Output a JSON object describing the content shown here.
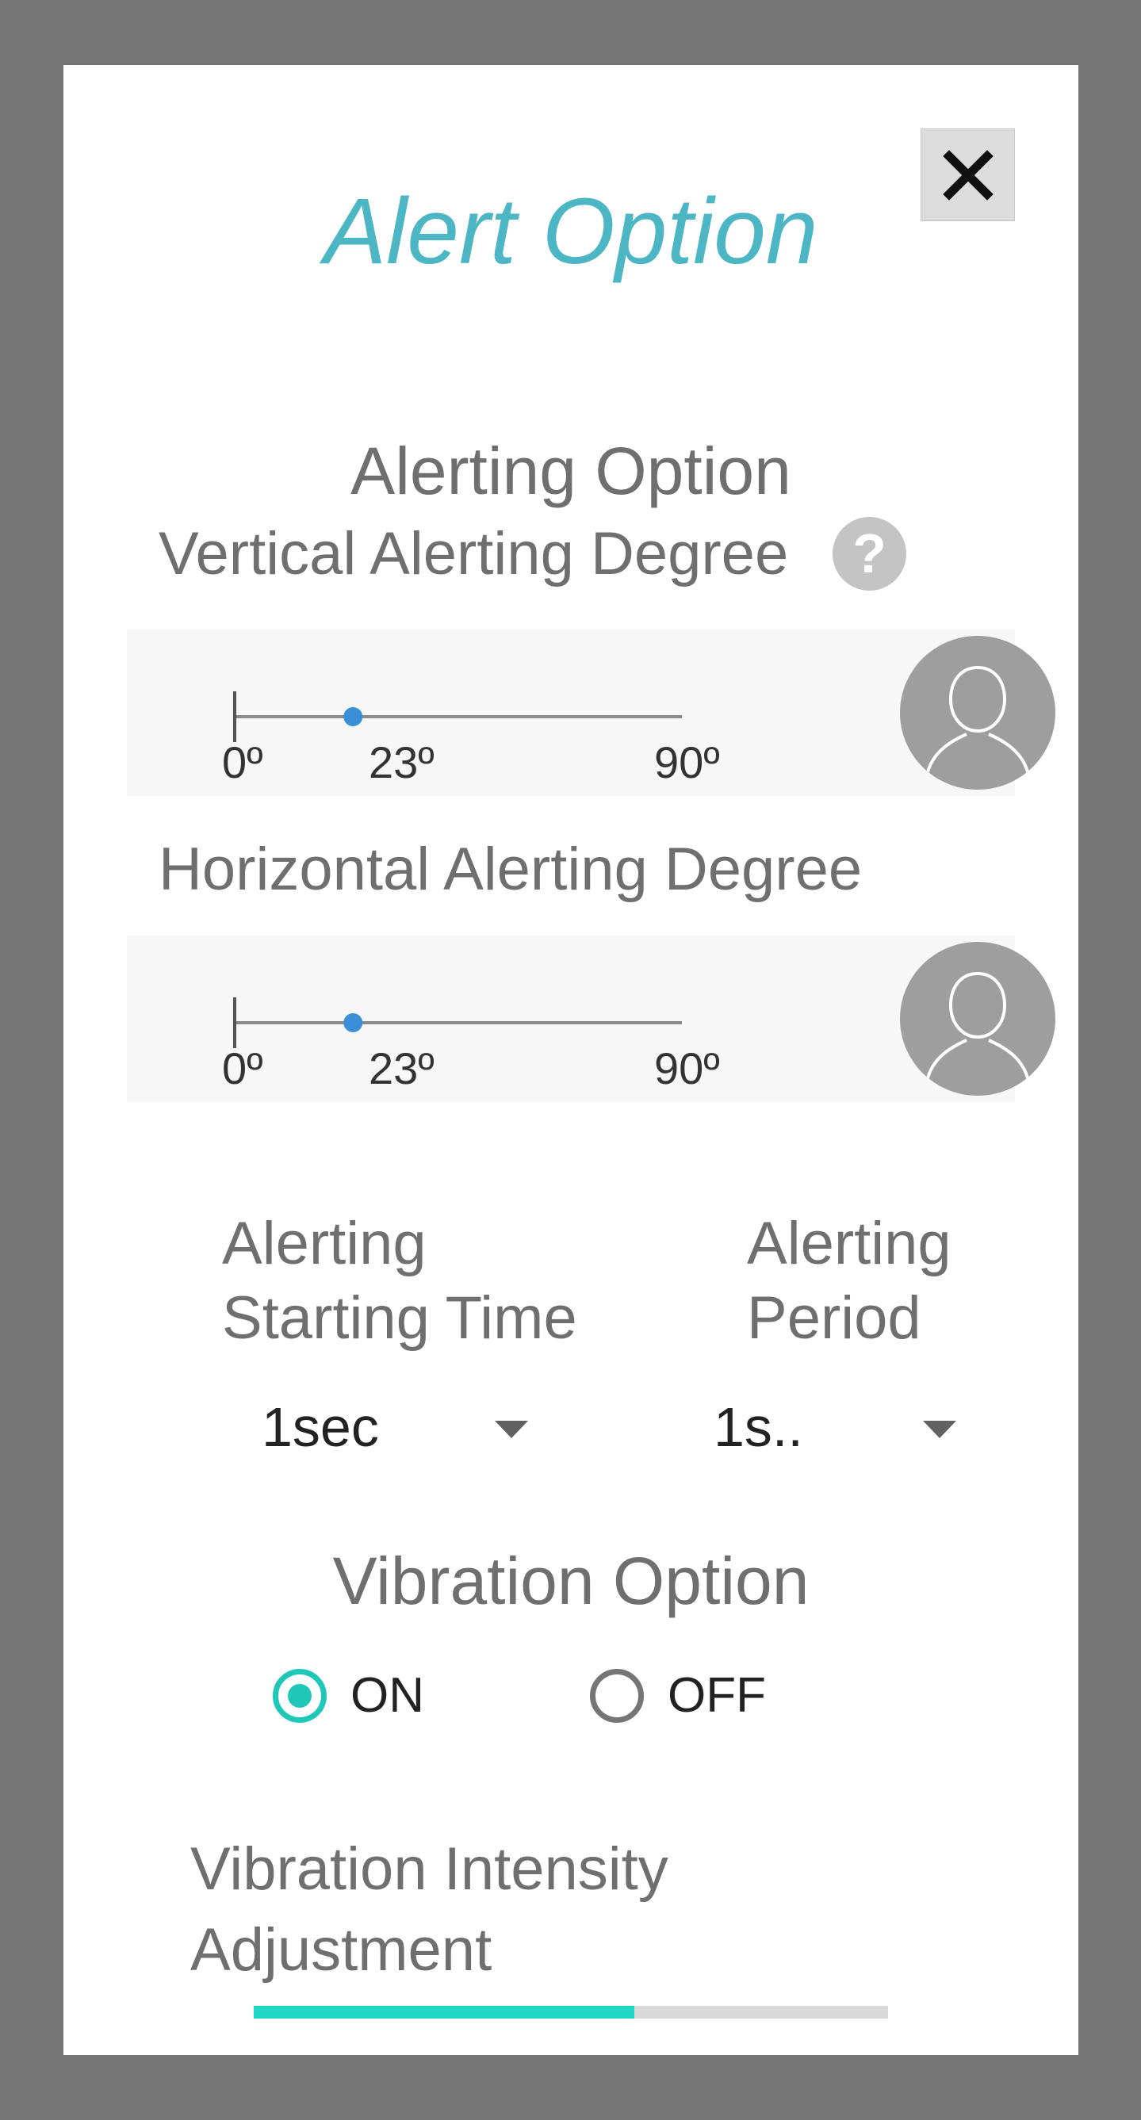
{
  "dialog": {
    "title": "Alert Option",
    "close_icon": "close-icon"
  },
  "alerting": {
    "section_title": "Alerting Option",
    "vertical": {
      "label": "Vertical Alerting Degree",
      "help_icon": "question-icon",
      "help_glyph": "?",
      "min_label": "0º",
      "current_label": "23º",
      "max_label": "90º",
      "min": 0,
      "max": 90,
      "value": 23
    },
    "horizontal": {
      "label": "Horizontal Alerting Degree",
      "min_label": "0º",
      "current_label": "23º",
      "max_label": "90º",
      "min": 0,
      "max": 90,
      "value": 23
    },
    "starting_time": {
      "label_line1": "Alerting",
      "label_line2": "Starting Time",
      "value": "1sec"
    },
    "period": {
      "label_line1": "Alerting",
      "label_line2": "Period",
      "value": "1s.."
    }
  },
  "vibration": {
    "section_title": "Vibration Option",
    "on_label": "ON",
    "off_label": "OFF",
    "selected": "ON",
    "intensity_label_line1": "Vibration Intensity",
    "intensity_label_line2": "Adjustment",
    "intensity_fraction": 0.6
  },
  "colors": {
    "accent": "#1fd6c4",
    "title": "#4db6c4",
    "slider_dot": "#3a8fd8"
  }
}
